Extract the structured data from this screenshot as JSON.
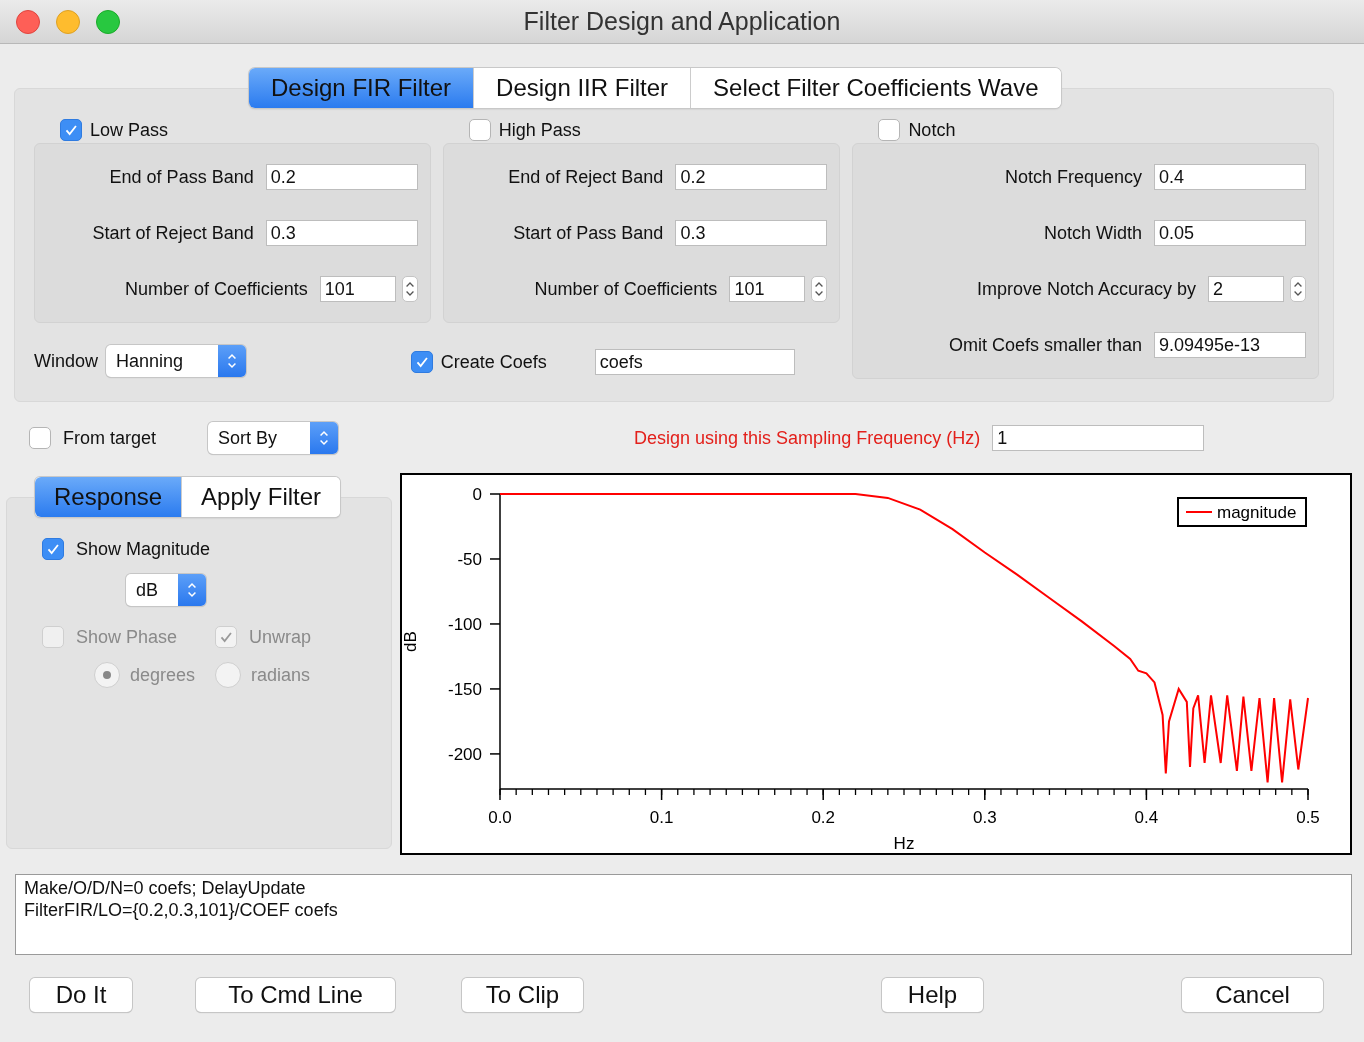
{
  "window": {
    "title": "Filter Design and Application"
  },
  "tabs": [
    {
      "label": "Design FIR Filter",
      "selected": true
    },
    {
      "label": "Design IIR Filter",
      "selected": false
    },
    {
      "label": "Select Filter Coefficients Wave",
      "selected": false
    }
  ],
  "sections": [
    {
      "label": "Low Pass",
      "checked": true,
      "fields": [
        {
          "label": "End of Pass Band",
          "value": "0.2",
          "kind": "text"
        },
        {
          "label": "Start of Reject Band",
          "value": "0.3",
          "kind": "text"
        },
        {
          "label": "Number of Coefficients",
          "value": "101",
          "kind": "stepper"
        }
      ]
    },
    {
      "label": "High Pass",
      "checked": false,
      "fields": [
        {
          "label": "End of Reject Band",
          "value": "0.2",
          "kind": "text"
        },
        {
          "label": "Start of Pass Band",
          "value": "0.3",
          "kind": "text"
        },
        {
          "label": "Number of Coefficients",
          "value": "101",
          "kind": "stepper"
        }
      ]
    },
    {
      "label": "Notch",
      "checked": false,
      "fields": [
        {
          "label": "Notch Frequency",
          "value": "0.4",
          "kind": "text"
        },
        {
          "label": "Notch Width",
          "value": "0.05",
          "kind": "text"
        },
        {
          "label": "Improve Notch Accuracy by",
          "value": "2",
          "kind": "stepper"
        },
        {
          "label": "Omit Coefs smaller than",
          "value": "9.09495e-13",
          "kind": "text"
        }
      ]
    }
  ],
  "window_menu": {
    "label": "Window",
    "value": "Hanning"
  },
  "create_coefs": {
    "label": "Create Coefs",
    "checked": true,
    "value": "coefs"
  },
  "from_target": {
    "label": "From target",
    "checked": false
  },
  "sort_by": {
    "value": "Sort By"
  },
  "sampling": {
    "label": "Design using this Sampling Frequency (Hz)",
    "value": "1"
  },
  "sub_tabs": [
    {
      "label": "Response",
      "selected": true
    },
    {
      "label": "Apply Filter",
      "selected": false
    }
  ],
  "response": {
    "show_magnitude": {
      "label": "Show Magnitude",
      "checked": true
    },
    "unit": {
      "value": "dB"
    },
    "show_phase": {
      "label": "Show Phase",
      "checked": false,
      "disabled": true
    },
    "unwrap": {
      "label": "Unwrap",
      "checked": true,
      "disabled": true
    },
    "phase_units": [
      {
        "label": "degrees",
        "selected": true,
        "disabled": true
      },
      {
        "label": "radians",
        "selected": false,
        "disabled": true
      }
    ]
  },
  "chart_data": {
    "type": "line",
    "xlabel": "Hz",
    "ylabel": "dB",
    "xlim": [
      0,
      0.5
    ],
    "ylim": [
      -227,
      0
    ],
    "xticks": [
      {
        "value": 0,
        "label": "0.0"
      },
      {
        "value": 0.1,
        "label": "0.1"
      },
      {
        "value": 0.2,
        "label": "0.2"
      },
      {
        "value": 0.3,
        "label": "0.3"
      },
      {
        "value": 0.4,
        "label": "0.4"
      },
      {
        "value": 0.5,
        "label": "0.5"
      }
    ],
    "yticks": [
      0,
      -50,
      -100,
      -150,
      -200
    ],
    "x": [
      0,
      0.22,
      0.24,
      0.26,
      0.28,
      0.3,
      0.32,
      0.34,
      0.36,
      0.38,
      0.39,
      0.395,
      0.4,
      0.405,
      0.41,
      0.412,
      0.414,
      0.42,
      0.425,
      0.427,
      0.429,
      0.432,
      0.436,
      0.44,
      0.446,
      0.45,
      0.456,
      0.46,
      0.465,
      0.47,
      0.475,
      0.479,
      0.484,
      0.489,
      0.494,
      0.5
    ],
    "series": [
      {
        "name": "magnitude",
        "color": "#ff0000",
        "values": [
          0,
          0,
          -3,
          -12,
          -27,
          -45,
          -62,
          -80,
          -98,
          -117,
          -127,
          -136,
          -138,
          -145,
          -170,
          -215,
          -175,
          -150,
          -160,
          -210,
          -165,
          -155,
          -207,
          -155,
          -207,
          -155,
          -213,
          -156,
          -213,
          -157,
          -222,
          -157,
          -222,
          -158,
          -212,
          -157
        ]
      }
    ]
  },
  "command_lines": [
    "Make/O/D/N=0 coefs; DelayUpdate",
    "FilterFIR/LO={0.2,0.3,101}/COEF coefs"
  ],
  "buttons": [
    "Do It",
    "To Cmd Line",
    "To Clip",
    "Help",
    "Cancel"
  ]
}
